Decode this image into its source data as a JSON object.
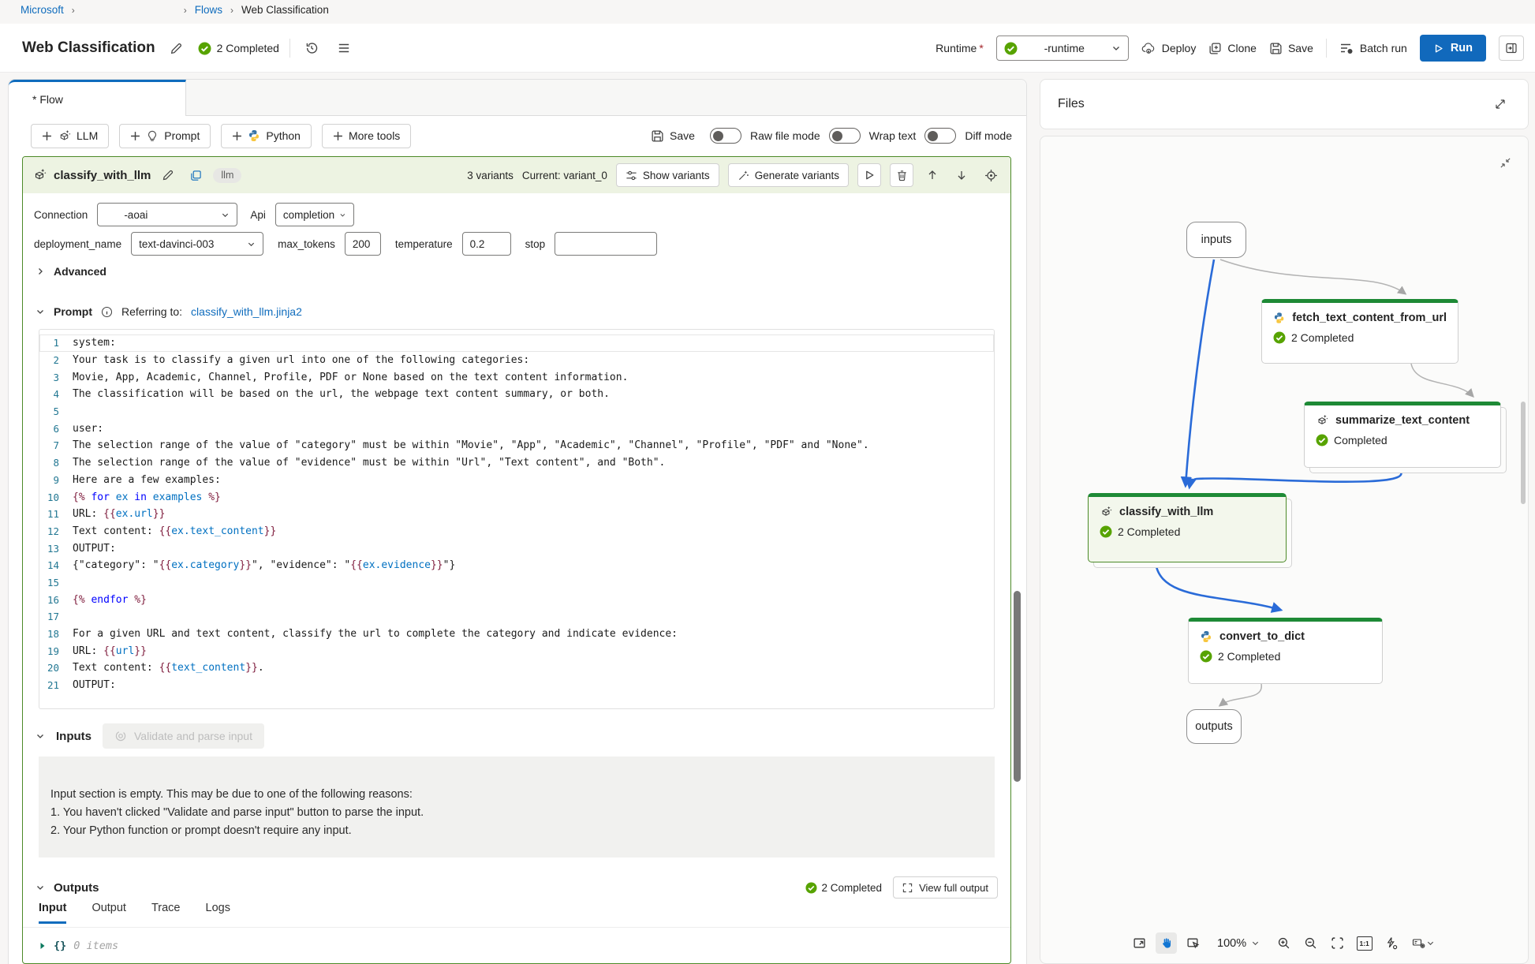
{
  "breadcrumb": {
    "microsoft": "Microsoft",
    "flows": "Flows",
    "current": "Web Classification"
  },
  "header": {
    "title": "Web Classification",
    "status_badge": "2 Completed",
    "runtime_label": "Runtime",
    "runtime_required_mark": "*",
    "runtime_value": "-runtime",
    "deploy": "Deploy",
    "clone": "Clone",
    "save": "Save",
    "batch_run": "Batch run",
    "run": "Run"
  },
  "tabs": {
    "flow": "* Flow"
  },
  "toolbar": {
    "llm": "LLM",
    "prompt": "Prompt",
    "python": "Python",
    "more_tools": "More tools",
    "save": "Save",
    "raw_file_mode": "Raw file mode",
    "wrap_text": "Wrap text",
    "diff_mode": "Diff mode"
  },
  "node": {
    "name": "classify_with_llm",
    "badge": "llm",
    "variants": "3 variants",
    "current_variant": "Current: variant_0",
    "show_variants": "Show variants",
    "generate_variants": "Generate variants",
    "connection_label": "Connection",
    "connection_value": "-aoai",
    "api_label": "Api",
    "api_value": "completion",
    "deployment_label": "deployment_name",
    "deployment_value": "text-davinci-003",
    "max_tokens_label": "max_tokens",
    "max_tokens_value": "200",
    "temperature_label": "temperature",
    "temperature_value": "0.2",
    "stop_label": "stop",
    "advanced": "Advanced",
    "prompt_label": "Prompt",
    "referring_label": "Referring to:",
    "referring_file": "classify_with_llm.jinja2"
  },
  "code": {
    "lines": [
      [
        [
          "pl",
          "system:"
        ]
      ],
      [
        [
          "pl",
          "Your task is to classify a given url into one of the following categories:"
        ]
      ],
      [
        [
          "pl",
          "Movie, App, Academic, Channel, Profile, PDF or None based on the text content information."
        ]
      ],
      [
        [
          "pl",
          "The classification will be based on the url, the webpage text content summary, or both."
        ]
      ],
      [],
      [
        [
          "pl",
          "user:"
        ]
      ],
      [
        [
          "pl",
          "The selection range of the value of \"category\" must be within \"Movie\", \"App\", \"Academic\", \"Channel\", \"Profile\", \"PDF\" and \"None\"."
        ]
      ],
      [
        [
          "pl",
          "The selection range of the value of \"evidence\" must be within \"Url\", \"Text content\", and \"Both\"."
        ]
      ],
      [
        [
          "pl",
          "Here are a few examples:"
        ]
      ],
      [
        [
          "jd",
          "{%"
        ],
        [
          "pl",
          " "
        ],
        [
          "kw",
          "for"
        ],
        [
          "pl",
          " "
        ],
        [
          "id",
          "ex"
        ],
        [
          "pl",
          " "
        ],
        [
          "kw",
          "in"
        ],
        [
          "pl",
          " "
        ],
        [
          "id",
          "examples"
        ],
        [
          "pl",
          " "
        ],
        [
          "jd",
          "%}"
        ]
      ],
      [
        [
          "pl",
          "URL: "
        ],
        [
          "jd",
          "{{"
        ],
        [
          "id",
          "ex.url"
        ],
        [
          "jd",
          "}}"
        ]
      ],
      [
        [
          "pl",
          "Text content: "
        ],
        [
          "jd",
          "{{"
        ],
        [
          "id",
          "ex.text_content"
        ],
        [
          "jd",
          "}}"
        ]
      ],
      [
        [
          "pl",
          "OUTPUT:"
        ]
      ],
      [
        [
          "pl",
          "{\"category\": \""
        ],
        [
          "jd",
          "{{"
        ],
        [
          "id",
          "ex.category"
        ],
        [
          "jd",
          "}}"
        ],
        [
          "pl",
          "\", \"evidence\": \""
        ],
        [
          "jd",
          "{{"
        ],
        [
          "id",
          "ex.evidence"
        ],
        [
          "jd",
          "}}"
        ],
        [
          "pl",
          "\"}"
        ]
      ],
      [],
      [
        [
          "jd",
          "{%"
        ],
        [
          "pl",
          " "
        ],
        [
          "kw",
          "endfor"
        ],
        [
          "pl",
          " "
        ],
        [
          "jd",
          "%}"
        ]
      ],
      [],
      [
        [
          "pl",
          "For a given URL and text content, classify the url to complete the category and indicate evidence:"
        ]
      ],
      [
        [
          "pl",
          "URL: "
        ],
        [
          "jd",
          "{{"
        ],
        [
          "id",
          "url"
        ],
        [
          "jd",
          "}}"
        ]
      ],
      [
        [
          "pl",
          "Text content: "
        ],
        [
          "jd",
          "{{"
        ],
        [
          "id",
          "text_content"
        ],
        [
          "jd",
          "}}"
        ],
        [
          "pl",
          "."
        ]
      ],
      [
        [
          "pl",
          "OUTPUT:"
        ]
      ]
    ]
  },
  "inputs": {
    "label": "Inputs",
    "validate_button": "Validate and parse input",
    "empty_lines": [
      "Input section is empty. This may be due to one of the following reasons:",
      "1. You haven't clicked \"Validate and parse input\" button to parse the input.",
      "2. Your Python function or prompt doesn't require any input."
    ]
  },
  "outputs": {
    "label": "Outputs",
    "status": "2 Completed",
    "view_full_output": "View full output",
    "tabs": [
      "Input",
      "Output",
      "Trace",
      "Logs"
    ],
    "brace": "{}",
    "empty_value": "0 items"
  },
  "files_panel": {
    "title": "Files"
  },
  "graph": {
    "zoom_level": "100%",
    "actual_size_label": "1:1",
    "nodes": {
      "inputs": {
        "label": "inputs"
      },
      "fetch": {
        "label": "fetch_text_content_from_url",
        "status": "2 Completed"
      },
      "summarize": {
        "label": "summarize_text_content",
        "status": "Completed"
      },
      "classify": {
        "label": "classify_with_llm",
        "status": "2 Completed"
      },
      "convert": {
        "label": "convert_to_dict",
        "status": "2 Completed"
      },
      "outputs": {
        "label": "outputs"
      }
    }
  },
  "colors": {
    "accent_blue": "#0f6cbd",
    "status_green": "#57a300",
    "node_top_green": "#1e8a36",
    "edge_blue": "#2a6bd8"
  }
}
